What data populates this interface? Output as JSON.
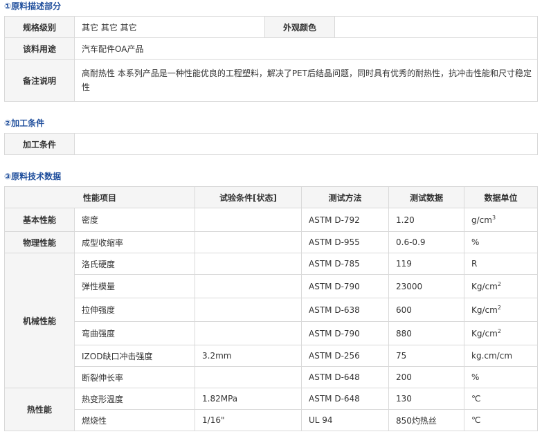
{
  "sections": {
    "desc_title": "①原料描述部分",
    "proc_title": "②加工条件",
    "tech_title": "③原料技术数据"
  },
  "desc": {
    "spec_label": "规格级别",
    "spec_value": "其它 其它 其它",
    "color_label": "外观颜色",
    "color_value": "",
    "use_label": "该料用途",
    "use_value": "汽车配件OA产品",
    "note_label": "备注说明",
    "note_value": "高耐热性 本系列产品是一种性能优良的工程塑料，解决了PET后结晶问题，同时具有优秀的耐热性，抗冲击性能和尺寸稳定性"
  },
  "proc": {
    "label": "加工条件",
    "value": ""
  },
  "tech": {
    "headers": [
      "性能项目",
      "试验条件[状态]",
      "测试方法",
      "测试数据",
      "数据单位"
    ],
    "groups": {
      "basic": "基本性能",
      "physical": "物理性能",
      "mechanical": "机械性能",
      "thermal": "热性能"
    },
    "rows": [
      {
        "item": "密度",
        "cond": "",
        "method": "ASTM D-792",
        "value": "1.20",
        "unit": "g/cm",
        "sup": "3"
      },
      {
        "item": "成型收缩率",
        "cond": "",
        "method": "ASTM D-955",
        "value": "0.6-0.9",
        "unit": "%",
        "sup": ""
      },
      {
        "item": "洛氏硬度",
        "cond": "",
        "method": "ASTM D-785",
        "value": "119",
        "unit": "R",
        "sup": ""
      },
      {
        "item": "弹性模量",
        "cond": "",
        "method": "ASTM D-790",
        "value": "23000",
        "unit": "Kg/cm",
        "sup": "2"
      },
      {
        "item": "拉伸强度",
        "cond": "",
        "method": "ASTM D-638",
        "value": "600",
        "unit": "Kg/cm",
        "sup": "2"
      },
      {
        "item": "弯曲强度",
        "cond": "",
        "method": "ASTM D-790",
        "value": "880",
        "unit": "Kg/cm",
        "sup": "2"
      },
      {
        "item": "IZOD缺口冲击强度",
        "cond": "3.2mm",
        "method": "ASTM D-256",
        "value": "75",
        "unit": "kg.cm/cm",
        "sup": ""
      },
      {
        "item": "断裂伸长率",
        "cond": "",
        "method": "ASTM D-648",
        "value": "200",
        "unit": "%",
        "sup": ""
      },
      {
        "item": "热变形温度",
        "cond": "1.82MPa",
        "method": "ASTM D-648",
        "value": "130",
        "unit": "℃",
        "sup": ""
      },
      {
        "item": "燃烧性",
        "cond": "1/16\"",
        "method": "UL 94",
        "value": "850灼热丝",
        "unit": "℃",
        "sup": ""
      }
    ]
  }
}
